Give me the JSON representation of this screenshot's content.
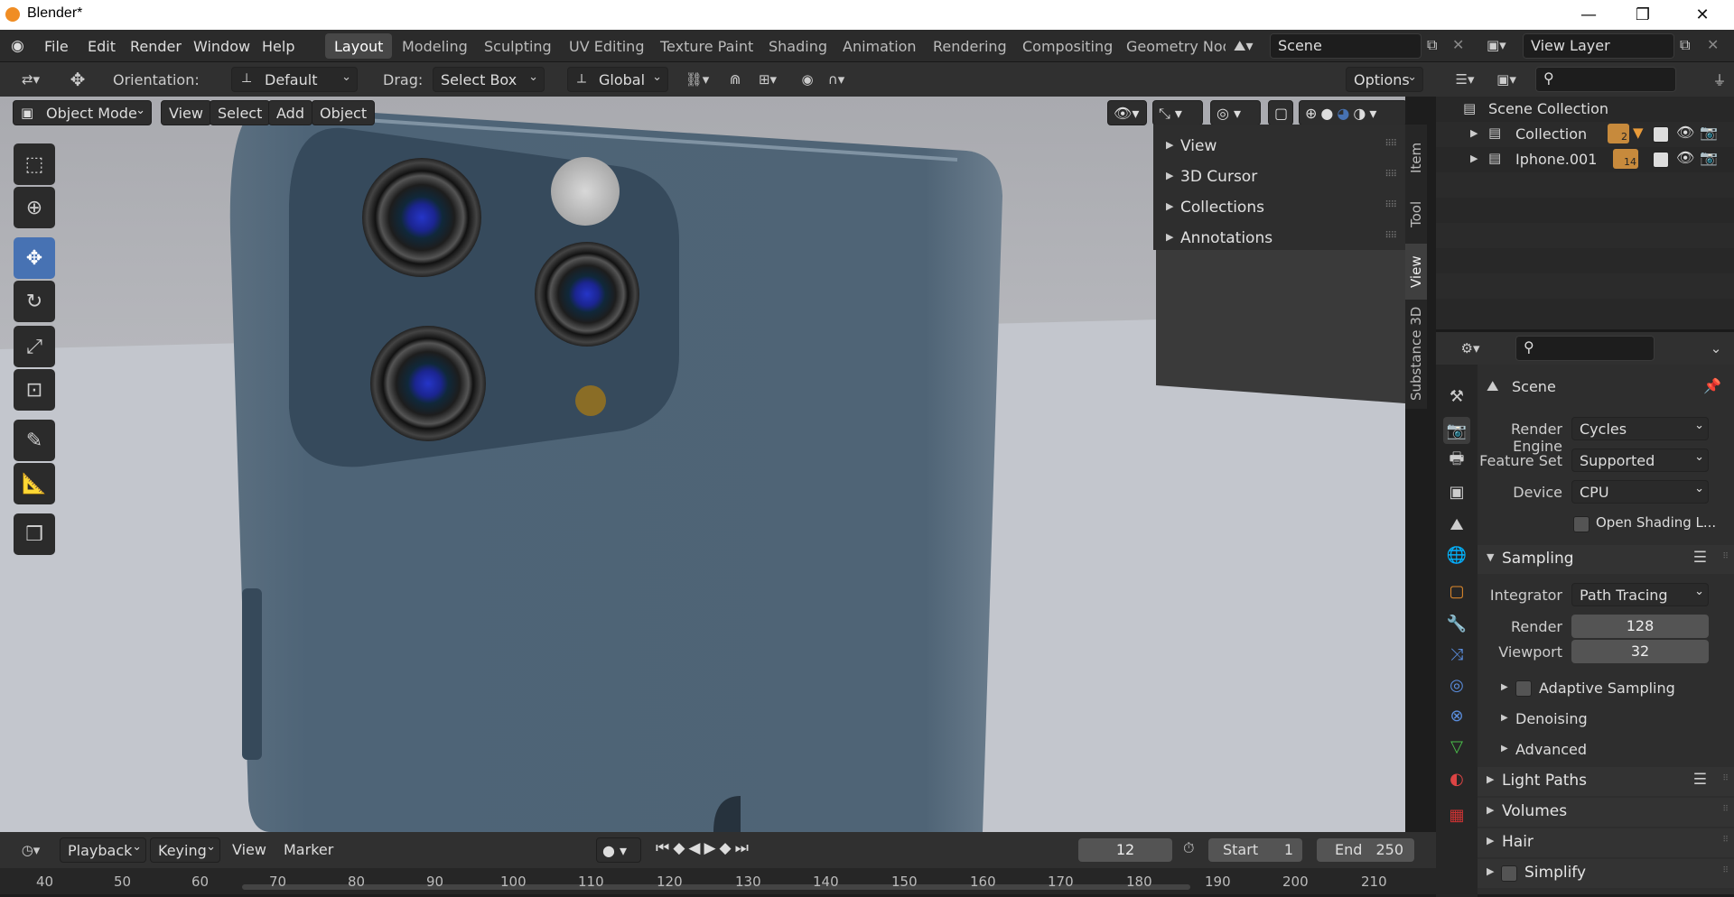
{
  "window": {
    "title": "Blender*",
    "minimize": "—",
    "restore": "❐",
    "close": "✕"
  },
  "menu": [
    "File",
    "Edit",
    "Render",
    "Window",
    "Help"
  ],
  "workspaces": [
    "Layout",
    "Modeling",
    "Sculpting",
    "UV Editing",
    "Texture Paint",
    "Shading",
    "Animation",
    "Rendering",
    "Compositing",
    "Geometry Nod"
  ],
  "scene_field": "Scene",
  "view_layer_field": "View Layer",
  "header": {
    "orientation_label": "Orientation:",
    "orientation_value": "Default",
    "drag_label": "Drag:",
    "drag_value": "Select Box",
    "transform_value": "Global",
    "options": "Options"
  },
  "viewport": {
    "mode": "Object Mode",
    "menus": [
      "View",
      "Select",
      "Add",
      "Object"
    ]
  },
  "npanel": {
    "items": [
      "View",
      "3D Cursor",
      "Collections",
      "Annotations"
    ],
    "tabs": [
      "Item",
      "Tool",
      "View",
      "Substance 3D"
    ]
  },
  "outliner": {
    "root": "Scene Collection",
    "rows": [
      {
        "label": "Collection",
        "badge": "2"
      },
      {
        "label": "Iphone.001",
        "badge": "14"
      }
    ]
  },
  "properties": {
    "context": "Scene",
    "render_engine_label": "Render Engine",
    "render_engine": "Cycles",
    "feature_set_label": "Feature Set",
    "feature_set": "Supported",
    "device_label": "Device",
    "device": "CPU",
    "osl_label": "Open Shading L...",
    "sampling": "Sampling",
    "integrator_label": "Integrator",
    "integrator": "Path Tracing",
    "render_label": "Render",
    "render_samples": "128",
    "viewport_label": "Viewport",
    "viewport_samples": "32",
    "adaptive": "Adaptive Sampling",
    "denoising": "Denoising",
    "advanced": "Advanced",
    "light_paths": "Light Paths",
    "volumes": "Volumes",
    "hair": "Hair",
    "simplify": "Simplify"
  },
  "timeline": {
    "menus": [
      "Playback",
      "Keying",
      "View",
      "Marker"
    ],
    "current_frame": "12",
    "start_label": "Start",
    "start": "1",
    "end_label": "End",
    "end": "250",
    "ruler": [
      "40",
      "50",
      "60",
      "70",
      "80",
      "90",
      "100",
      "110",
      "120",
      "130",
      "140",
      "150",
      "160",
      "170",
      "180",
      "190",
      "200",
      "210"
    ]
  },
  "colors": {
    "accent": "#4772b3",
    "phone": "#4a6072",
    "camera_bump": "#364a5c"
  }
}
